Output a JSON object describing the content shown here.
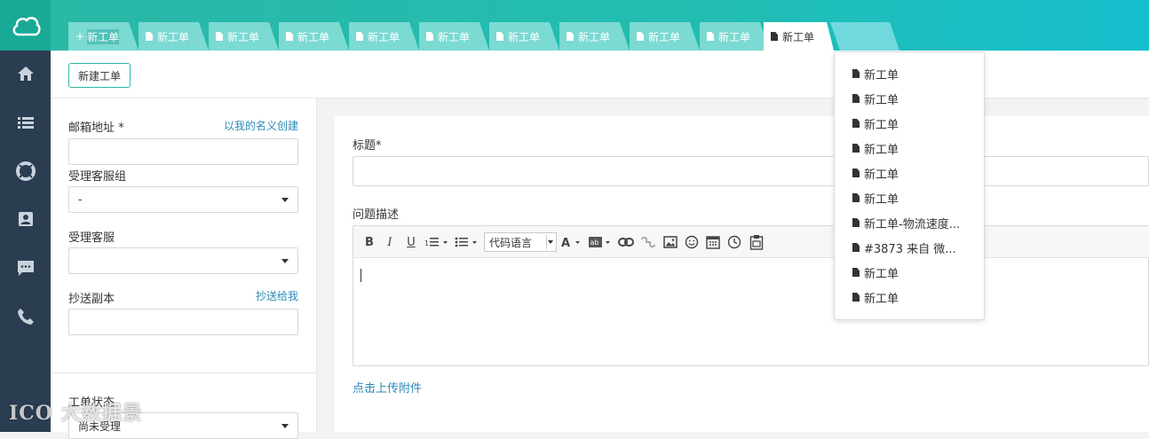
{
  "tabs": [
    {
      "label": "新工单",
      "icon": "plus-icon"
    },
    {
      "label": "新工单",
      "icon": "doc-icon"
    },
    {
      "label": "新工单",
      "icon": "doc-icon"
    },
    {
      "label": "新工单",
      "icon": "doc-icon"
    },
    {
      "label": "新工单",
      "icon": "doc-icon"
    },
    {
      "label": "新工单",
      "icon": "doc-icon"
    },
    {
      "label": "新工单",
      "icon": "doc-icon"
    },
    {
      "label": "新工单",
      "icon": "doc-icon"
    },
    {
      "label": "新工单",
      "icon": "doc-icon"
    },
    {
      "label": "新工单",
      "icon": "doc-icon"
    },
    {
      "label": "新工单",
      "icon": "doc-icon"
    }
  ],
  "sidebar": {
    "icons": [
      "home-icon",
      "list-icon",
      "lifebuoy-icon",
      "contact-card-icon",
      "chat-icon",
      "phone-icon"
    ]
  },
  "toolbar": {
    "new_ticket_label": "新建工单"
  },
  "form": {
    "email_label": "邮箱地址 *",
    "create_as_me": "以我的名义创建",
    "group_label": "受理客服组",
    "group_value": "-",
    "agent_label": "受理客服",
    "agent_value": "",
    "cc_label": "抄送副本",
    "cc_to_me": "抄送给我",
    "status_label": "工单状态",
    "status_value": "尚未受理"
  },
  "main": {
    "title_label": "标题*",
    "description_label": "问题描述",
    "code_language": "代码语言",
    "upload_link": "点击上传附件"
  },
  "dropdown": {
    "items": [
      "新工单",
      "新工单",
      "新工单",
      "新工单",
      "新工单",
      "新工单",
      "新工单-物流速度...",
      "#3873 来自 微...",
      "新工单",
      "新工单"
    ]
  },
  "watermark": "大数据景",
  "colors": {
    "brand": "#2bb7a6",
    "sidebar": "#2b3d51",
    "link": "#2a8ab5"
  }
}
